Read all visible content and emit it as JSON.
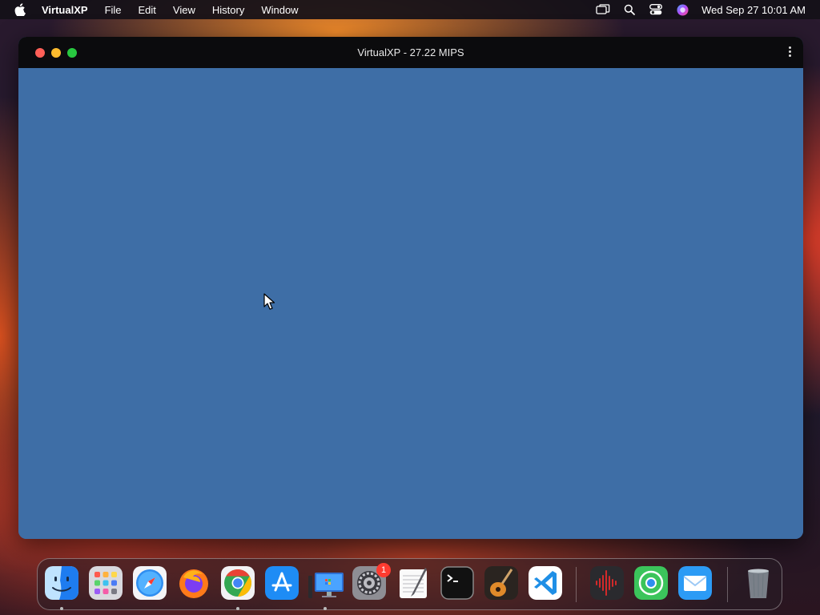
{
  "menubar": {
    "app_name": "VirtualXP",
    "items": [
      "File",
      "Edit",
      "View",
      "History",
      "Window"
    ],
    "clock": "Wed Sep 27  10:01 AM",
    "status_icons": [
      "screen-mirroring-icon",
      "spotlight-search-icon",
      "control-center-icon",
      "siri-icon"
    ]
  },
  "window": {
    "title": "VirtualXP - 27.22 MIPS",
    "screen_color": "#3e6ea6"
  },
  "dock": {
    "apps": [
      {
        "name": "Finder",
        "icon": "finder-icon",
        "running": true
      },
      {
        "name": "Launchpad",
        "icon": "launchpad-icon",
        "running": false
      },
      {
        "name": "Safari",
        "icon": "safari-icon",
        "running": false
      },
      {
        "name": "Firefox",
        "icon": "firefox-icon",
        "running": false
      },
      {
        "name": "Google Chrome",
        "icon": "chrome-icon",
        "running": true
      },
      {
        "name": "App Store",
        "icon": "app-store-icon",
        "running": false
      },
      {
        "name": "VirtualXP",
        "icon": "virtualxp-icon",
        "running": true
      },
      {
        "name": "System Settings",
        "icon": "system-settings-icon",
        "running": false,
        "badge": "1"
      },
      {
        "name": "TextEdit",
        "icon": "textedit-icon",
        "running": false
      },
      {
        "name": "Terminal",
        "icon": "terminal-icon",
        "running": false
      },
      {
        "name": "GarageBand",
        "icon": "garageband-icon",
        "running": false
      },
      {
        "name": "Visual Studio Code",
        "icon": "vscode-icon",
        "running": false
      },
      {
        "name": "Audio Editor",
        "icon": "waveform-icon",
        "running": false
      },
      {
        "name": "Find My",
        "icon": "find-my-icon",
        "running": false
      },
      {
        "name": "Mail",
        "icon": "mail-icon",
        "running": false
      },
      {
        "name": "Trash",
        "icon": "trash-icon",
        "running": false
      }
    ]
  }
}
